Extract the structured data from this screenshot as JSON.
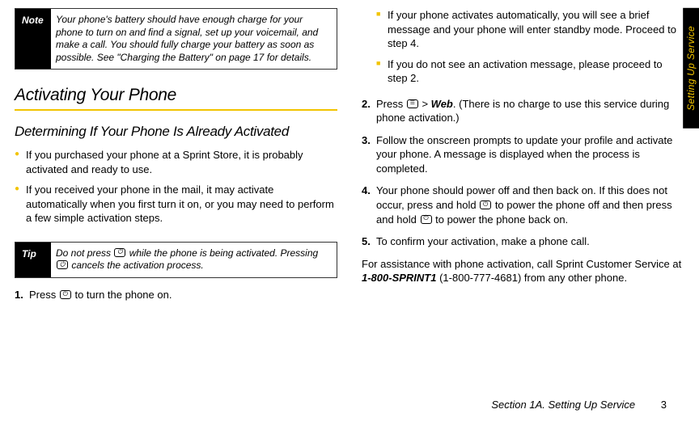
{
  "note": {
    "label": "Note",
    "text": "Your phone's battery should have enough charge for your phone to turn on and find a signal, set up your voicemail, and make a call. You should fully charge your battery as soon as possible. See \"Charging the Battery\" on page 17 for details."
  },
  "heading1": "Activating Your Phone",
  "heading2": "Determining If Your Phone Is Already Activated",
  "bullets": [
    "If you purchased your phone at a Sprint Store, it is probably activated and ready to use.",
    "If you received your phone in the mail, it may activate automatically when you first turn it on, or you may need to perform a few simple activation steps."
  ],
  "tip": {
    "label": "Tip",
    "prefix": "Do not press ",
    "mid": " while the phone is being activated. Pressing ",
    "suffix": " cancels the activation process."
  },
  "step1": {
    "num": "1.",
    "a": "Press ",
    "b": " to turn the phone on."
  },
  "sub": [
    "If your phone activates automatically, you will see a brief message and your phone will enter standby mode. Proceed to step 4.",
    "If you do not see an activation message, please proceed to step 2."
  ],
  "step2": {
    "num": "2.",
    "a": "Press ",
    "gt": " > ",
    "web": "Web",
    "b": ". (There is no charge to use this service during phone activation.)"
  },
  "step3": {
    "num": "3.",
    "text": "Follow the onscreen prompts to update your profile and activate your phone. A message is displayed when the process is completed."
  },
  "step4": {
    "num": "4.",
    "a": "Your phone should power off and then back on. If this does not occur, press and hold ",
    "b": " to power the phone off and then press and hold ",
    "c": " to power the phone back on."
  },
  "step5": {
    "num": "5.",
    "text": "To confirm your activation, make a phone call."
  },
  "assist": {
    "a": "For assistance with phone activation, call Sprint Customer Service at ",
    "num_bold": "1-800-SPRINT1",
    "b": " (1-800-777-4681) from any other phone."
  },
  "sideTab": "Setting Up Service",
  "footer": {
    "section": "Section 1A. Setting Up Service",
    "page": "3"
  }
}
